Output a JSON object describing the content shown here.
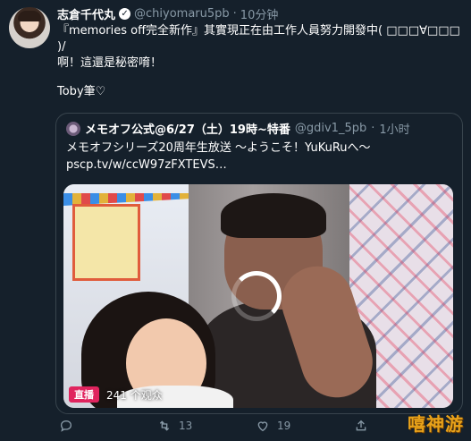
{
  "tweet": {
    "author_name": "志倉千代丸",
    "handle": "@chiyomaru5pb",
    "separator": "·",
    "time": "10分钟",
    "lines": [
      "『memories off完全新作』其實現正在由工作人員努力開發中( □□□∀□□□",
      ")/",
      "啊！這還是秘密唷！"
    ],
    "signature": "Toby筆♡"
  },
  "quote": {
    "author_name": "メモオフ公式@6/27（土）19時~特番",
    "handle": "@gdiv1_5pb",
    "separator": "·",
    "time": "1小时",
    "line1": "メモオフシリーズ20周年生放送 ～ようこそ！YuKuRuへ～",
    "line2": "pscp.tv/w/ccW97zFXTEVS…"
  },
  "video": {
    "live_label": "直播",
    "viewers": "241 个观众"
  },
  "actions": {
    "reply_count": "",
    "retweet_count": "13",
    "like_count": "19"
  },
  "watermark": "嘻神游",
  "colors": {
    "background": "#15202b",
    "muted": "#8899a6",
    "live": "#e0245e"
  }
}
